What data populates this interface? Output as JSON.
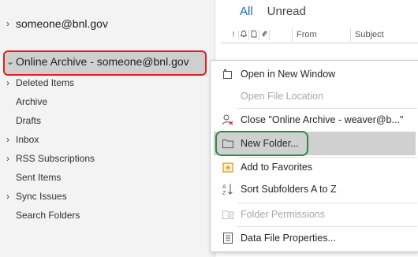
{
  "sidebar": {
    "account": "someone@bnl.gov",
    "archive": "Online Archive - someone@bnl.gov",
    "folders": [
      {
        "label": "Deleted Items",
        "expandable": true
      },
      {
        "label": "Archive",
        "expandable": false
      },
      {
        "label": "Drafts",
        "expandable": false
      },
      {
        "label": "Inbox",
        "expandable": true
      },
      {
        "label": "RSS Subscriptions",
        "expandable": true
      },
      {
        "label": "Sent Items",
        "expandable": false
      },
      {
        "label": "Sync Issues",
        "expandable": true
      },
      {
        "label": "Search Folders",
        "expandable": false
      }
    ]
  },
  "tabs": {
    "all": "All",
    "unread": "Unread"
  },
  "columns": {
    "flag_icons": [
      "!",
      "bell-icon",
      "document-icon",
      "paperclip-icon"
    ],
    "from": "From",
    "subject": "Subject"
  },
  "context_menu": {
    "open_new_window": "Open in New Window",
    "open_file_location": "Open File Location",
    "close": "Close \"Online Archive - weaver@b...\"",
    "new_folder": "New Folder...",
    "add_favorites": "Add to Favorites",
    "sort_subfolders": "Sort Subfolders A to Z",
    "folder_permissions": "Folder Permissions",
    "data_file_properties": "Data File Properties..."
  },
  "colors": {
    "accent": "#0f6cbd",
    "annotation_red": "#e02020",
    "annotation_green": "#2f8a4a"
  }
}
